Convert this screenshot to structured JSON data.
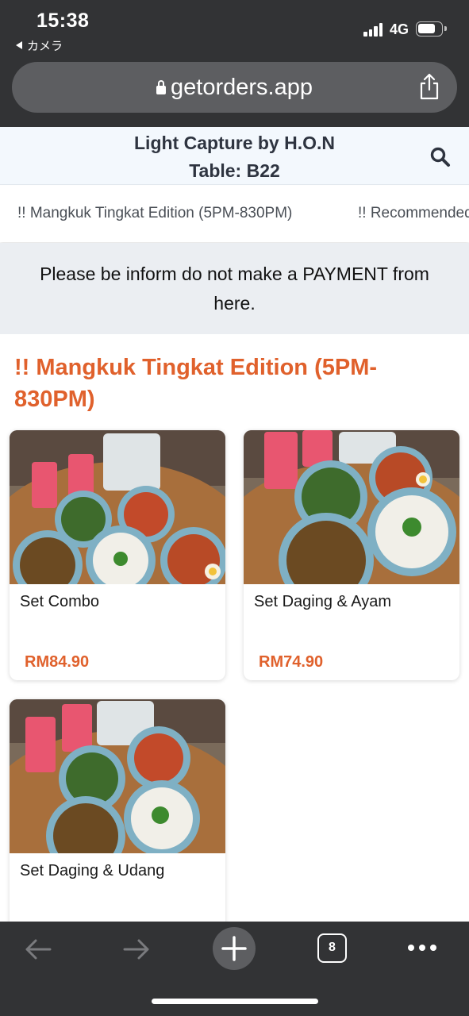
{
  "status_bar": {
    "time": "15:38",
    "back_app": "カメラ",
    "network": "4G"
  },
  "browser": {
    "url": "getorders.app",
    "tab_count": "8"
  },
  "header": {
    "store_name": "Light Capture by H.O.N",
    "table": "Table: B22"
  },
  "tabs": [
    {
      "label": "!! Mangkuk Tingkat Edition (5PM-830PM)"
    },
    {
      "label": "!! Recommended"
    }
  ],
  "notice": "Please be inform do not make a PAYMENT from here.",
  "section": {
    "title": "!! Mangkuk Tingkat Edition (5PM-830PM)",
    "items": [
      {
        "name": "Set Combo",
        "price": "RM84.90"
      },
      {
        "name": "Set Daging & Ayam",
        "price": "RM74.90"
      },
      {
        "name": "Set Daging & Udang",
        "price": ""
      }
    ]
  },
  "colors": {
    "accent": "#e0612c",
    "chrome": "#323335",
    "header_bg": "#f3f8fd",
    "notice_bg": "#ebeef2"
  }
}
